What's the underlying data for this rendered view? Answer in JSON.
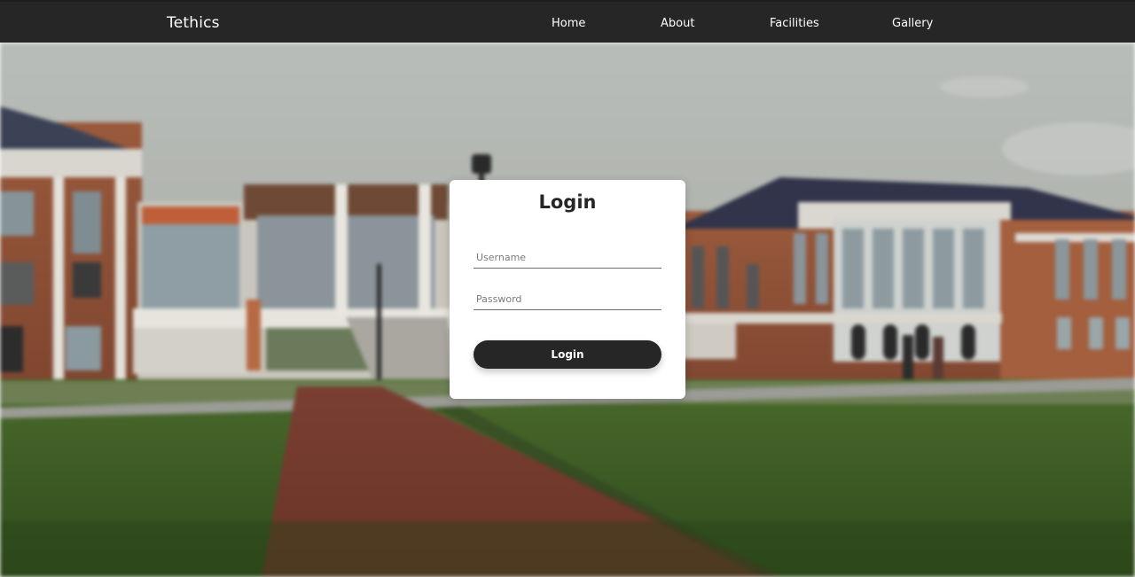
{
  "navbar": {
    "brand": "Tethics",
    "links": [
      "Home",
      "About",
      "Facilities",
      "Gallery"
    ]
  },
  "login": {
    "title": "Login",
    "username_placeholder": "Username",
    "password_placeholder": "Password",
    "button_label": "Login"
  },
  "colors": {
    "navbar_bg": "#262626",
    "card_bg": "#ffffff",
    "button_bg": "#262626",
    "text_light": "#ffffff",
    "text_dark": "#262626"
  }
}
